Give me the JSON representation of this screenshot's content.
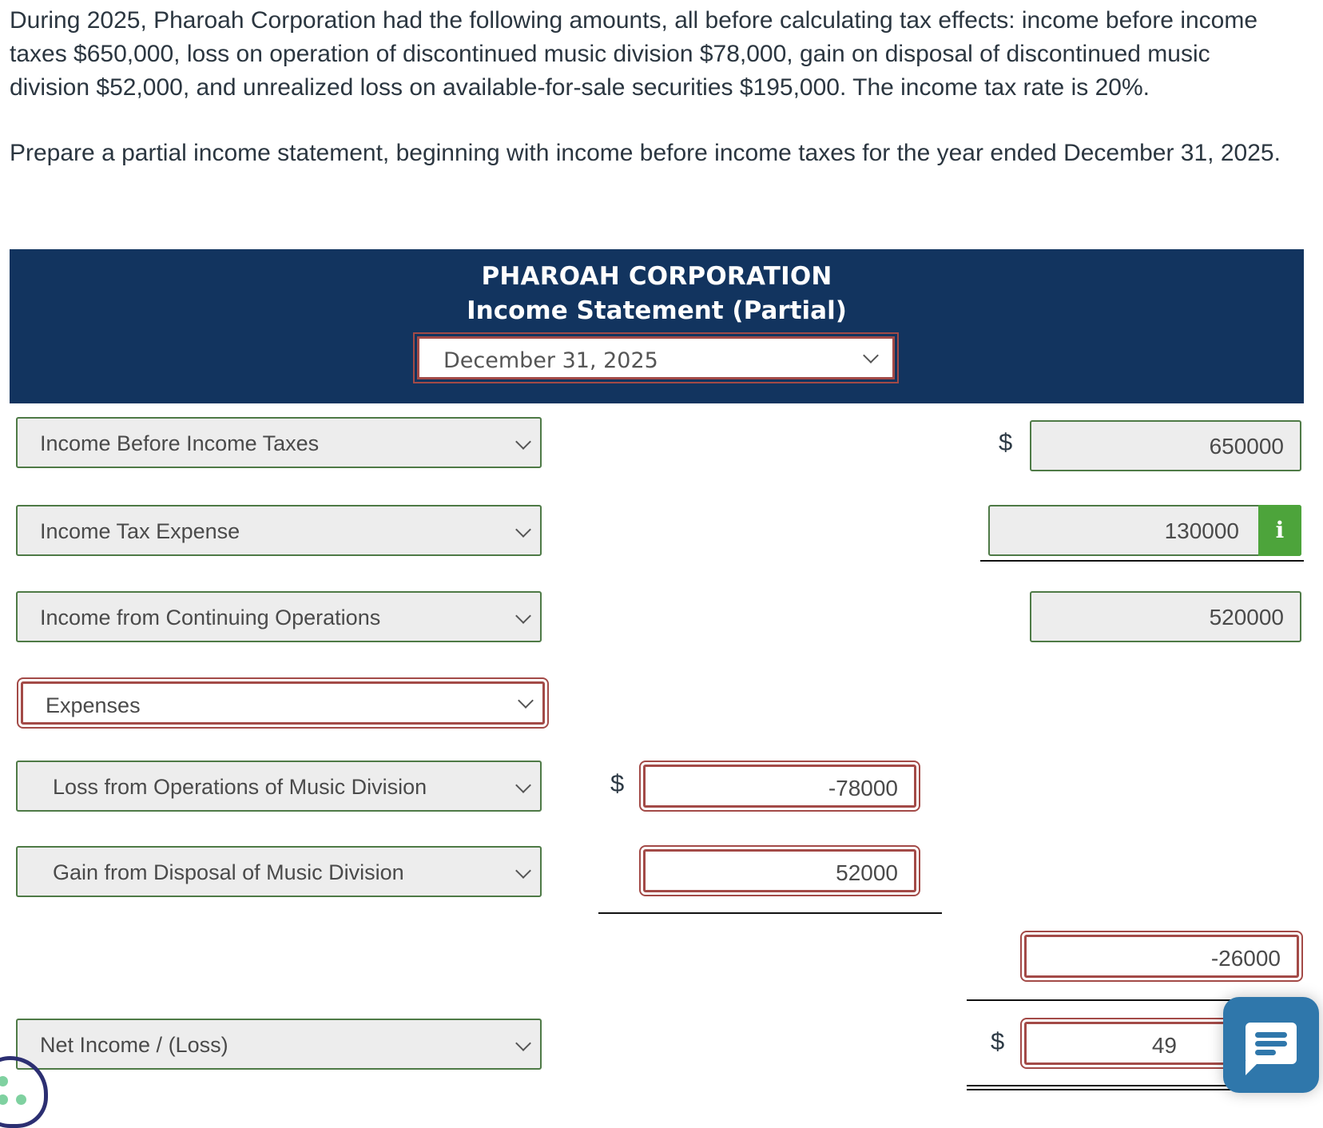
{
  "prompt": {
    "paragraph1": "During 2025, Pharoah Corporation had the following amounts, all before calculating tax effects: income before income taxes $650,000, loss on operation of discontinued music division $78,000, gain on disposal of discontinued music division $52,000, and unrealized loss on available-for-sale securities $195,000. The income tax rate is 20%.",
    "paragraph2": "Prepare a partial income statement, beginning with income before income taxes for the year ended December 31, 2025."
  },
  "header": {
    "company": "PHAROAH CORPORATION",
    "statement": "Income Statement (Partial)",
    "date_selected": "December 31, 2025"
  },
  "currency_symbol": "$",
  "rows": [
    {
      "label": "Income Before Income Taxes",
      "amount": "650000",
      "status": "correct"
    },
    {
      "label": "Income Tax Expense",
      "amount": "130000",
      "status": "correct",
      "info_icon": "i"
    },
    {
      "label": "Income from Continuing Operations",
      "amount": "520000",
      "status": "correct"
    },
    {
      "label": "Expenses",
      "amount": "",
      "status": "incorrect"
    },
    {
      "label": "Loss from Operations of Music Division",
      "amount": "-78000",
      "status": "incorrect"
    },
    {
      "label": "Gain from Disposal of Music Division",
      "amount": "52000",
      "status": "incorrect"
    },
    {
      "label": "",
      "amount": "-26000",
      "status": "incorrect"
    },
    {
      "label": "Net Income / (Loss)",
      "amount": "494000",
      "amount_visible": "49",
      "status": "incorrect"
    }
  ],
  "colors": {
    "header_bg": "#12345f",
    "correct_border": "#4e7a46",
    "incorrect_border": "#a34a47",
    "info_button": "#4da43b",
    "chat_button": "#2f77ab"
  }
}
